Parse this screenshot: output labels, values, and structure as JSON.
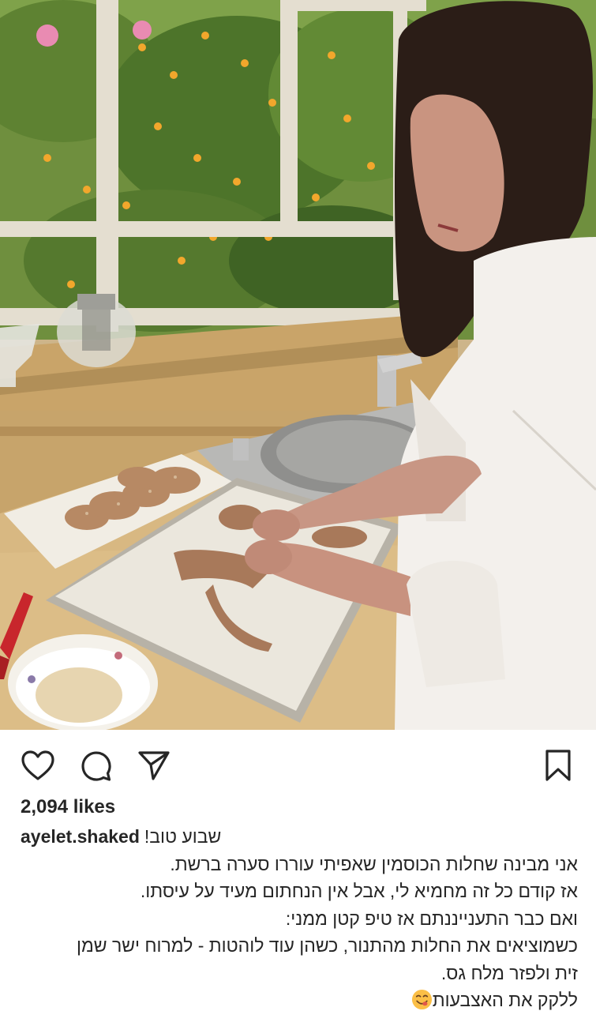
{
  "photo": {
    "alt_icon": "photo-woman-braiding-challah"
  },
  "actions": {
    "like_icon": "heart-icon",
    "comment_icon": "comment-icon",
    "share_icon": "send-icon",
    "save_icon": "bookmark-icon"
  },
  "post": {
    "likes": "2,094 likes",
    "username": "ayelet.shaked",
    "caption_first": "שבוע טוב!",
    "caption_lines": [
      "אני מבינה שחלות הכוסמין שאפיתי עוררו סערה ברשת.",
      "אז קודם כל זה מחמיא לי, אבל אין הנחתום מעיד על עיסתו.",
      "ואם כבר התענייננתם אז טיפ קטן ממני:",
      "כשמוציאים את החלות מהתנור, כשהן עוד לוהטות - למרוח ישר שמן",
      "זית ולפזר מלח גס.",
      "ללקק את האצבעות"
    ],
    "emoji_icon": "yum-face-emoji"
  },
  "colors": {
    "text": "#262626",
    "icon": "#262626",
    "emoji": "#fbbf47"
  }
}
